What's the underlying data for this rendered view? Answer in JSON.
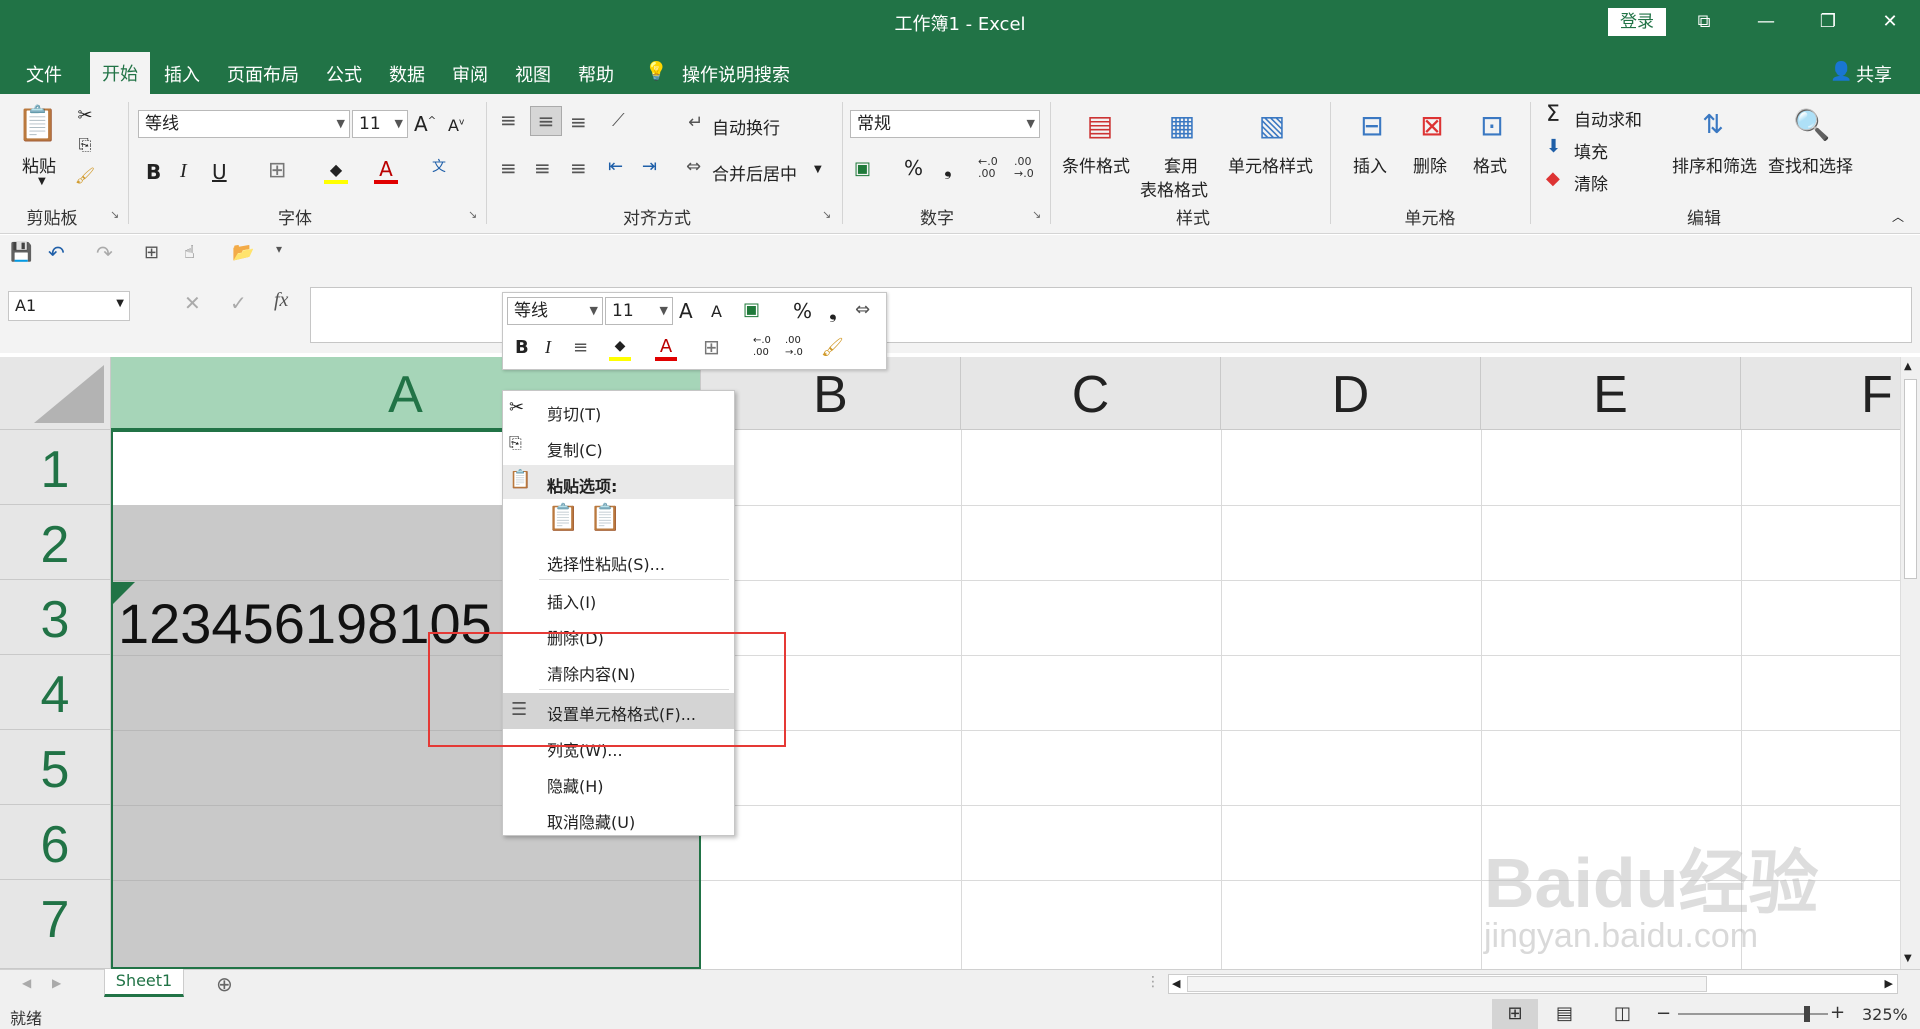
{
  "app": {
    "title": "工作簿1  -  Excel",
    "login": "登录",
    "share": "共享"
  },
  "tabs": [
    "文件",
    "开始",
    "插入",
    "页面布局",
    "公式",
    "数据",
    "审阅",
    "视图",
    "帮助"
  ],
  "tell_me": "操作说明搜索",
  "ribbon": {
    "paste": "粘贴",
    "font_name": "等线",
    "font_size": "11",
    "wrap_text": "自动换行",
    "merge_center": "合并后居中",
    "number_format": "常规",
    "cond_format": "条件格式",
    "table_format_1": "套用",
    "table_format_2": "表格格式",
    "cell_styles": "单元格样式",
    "insert": "插入",
    "delete": "删除",
    "format": "格式",
    "autosum": "自动求和",
    "fill": "填充",
    "clear": "清除",
    "sort_filter": "排序和筛选",
    "find_select": "查找和选择",
    "groups": {
      "clipboard": "剪贴板",
      "font": "字体",
      "alignment": "对齐方式",
      "number": "数字",
      "styles": "样式",
      "cells": "单元格",
      "editing": "编辑"
    }
  },
  "namebox": "A1",
  "columns": [
    "A",
    "B",
    "C",
    "D",
    "E",
    "F"
  ],
  "rows": [
    "1",
    "2",
    "3",
    "4",
    "5",
    "6",
    "7"
  ],
  "cell_a3": "123456198105",
  "mini_toolbar": {
    "font_name": "等线",
    "font_size": "11"
  },
  "context_menu": {
    "cut": "剪切(T)",
    "copy": "复制(C)",
    "paste_options": "粘贴选项:",
    "paste_special": "选择性粘贴(S)...",
    "insert": "插入(I)",
    "delete": "删除(D)",
    "clear": "清除内容(N)",
    "format_cells": "设置单元格格式(F)...",
    "col_width": "列宽(W)...",
    "hide": "隐藏(H)",
    "unhide": "取消隐藏(U)"
  },
  "sheet_tab": "Sheet1",
  "status": {
    "ready": "就绪",
    "zoom": "325%"
  },
  "watermark": {
    "logo": "Baidu经验",
    "url": "jingyan.baidu.com"
  },
  "colors": {
    "excel_green": "#217346",
    "highlight_red": "#e53935"
  }
}
